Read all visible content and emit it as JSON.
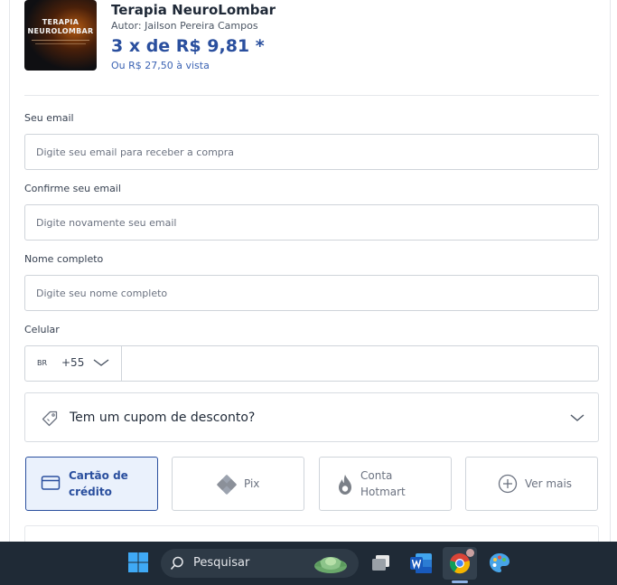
{
  "product": {
    "thumb_title": "TERAPIA NEUROLOMBAR",
    "title": "Terapia NeuroLombar",
    "author": "Autor: Jailson Pereira Campos",
    "price": "3 x de R$ 9,81 *",
    "cash": "Ou R$ 27,50 à vista"
  },
  "form": {
    "email_label": "Seu email",
    "email_placeholder": "Digite seu email para receber a compra",
    "confirm_label": "Confirme seu email",
    "confirm_placeholder": "Digite novamente seu email",
    "name_label": "Nome completo",
    "name_placeholder": "Digite seu nome completo",
    "phone_label": "Celular",
    "country_code": "BR",
    "dial_code": "+55"
  },
  "coupon": {
    "label": "Tem um cupom de desconto?"
  },
  "payment": {
    "options": [
      {
        "label": "Cartão de crédito",
        "icon": "credit-card-icon",
        "selected": true
      },
      {
        "label": "Pix",
        "icon": "pix-icon",
        "selected": false
      },
      {
        "label": "Conta Hotmart",
        "icon": "flame-icon",
        "selected": false
      },
      {
        "label": "Ver mais",
        "icon": "plus-circle-icon",
        "selected": false
      }
    ]
  },
  "taskbar": {
    "search_label": "Pesquisar"
  },
  "colors": {
    "accent": "#2a4f9e",
    "selected_bg": "#eaf1fc",
    "taskbar_bg": "#1f2a36"
  }
}
